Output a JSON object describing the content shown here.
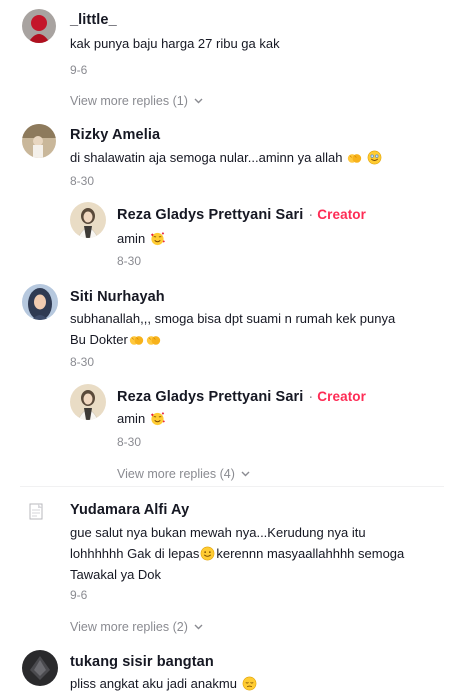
{
  "comments": [
    {
      "username": "_little_",
      "text": "kak punya baju harga 27 ribu ga kak",
      "date": "9-6",
      "more_replies": "View more replies (1)"
    },
    {
      "username": "Rizky Amelia",
      "text": "di shalawatin aja semoga nular...aminn ya allah",
      "date": "8-30",
      "reply": {
        "username": "Reza Gladys Prettyani Sari",
        "separator": "·",
        "badge": "Creator",
        "text": "amin",
        "date": "8-30"
      }
    },
    {
      "username": "Siti Nurhayah",
      "text_line1": "subhanallah,,, smoga bisa dpt suami n rumah kek punya",
      "text_line2": "Bu Dokter",
      "date": "8-30",
      "reply": {
        "username": "Reza Gladys Prettyani Sari",
        "separator": "·",
        "badge": "Creator",
        "text": "amin",
        "date": "8-30"
      },
      "more_replies": "View more replies (4)"
    },
    {
      "username": "Yudamara Alfi Ay",
      "text_line1": "gue salut nya bukan mewah nya...Kerudung nya itu",
      "text_line2a": "lohhhhhh Gak di lepas",
      "text_line2b": "kerennn masyaallahhhh semoga",
      "text_line3": "Tawakal ya Dok",
      "date": "9-6",
      "more_replies": "View more replies (2)"
    },
    {
      "username": "tukang sisir bangtan",
      "text": "pliss angkat aku jadi anakmu"
    }
  ],
  "icons": {
    "clap": "clapping-hands-emoji",
    "smile": "smiling-face-emoji",
    "hearts": "smiling-face-with-hearts-emoji",
    "sad": "pensive-face-emoji",
    "chevron": "chevron-down-icon"
  },
  "colors": {
    "text": "#161823",
    "muted": "#8a8b91",
    "creator": "#fe2c55"
  }
}
